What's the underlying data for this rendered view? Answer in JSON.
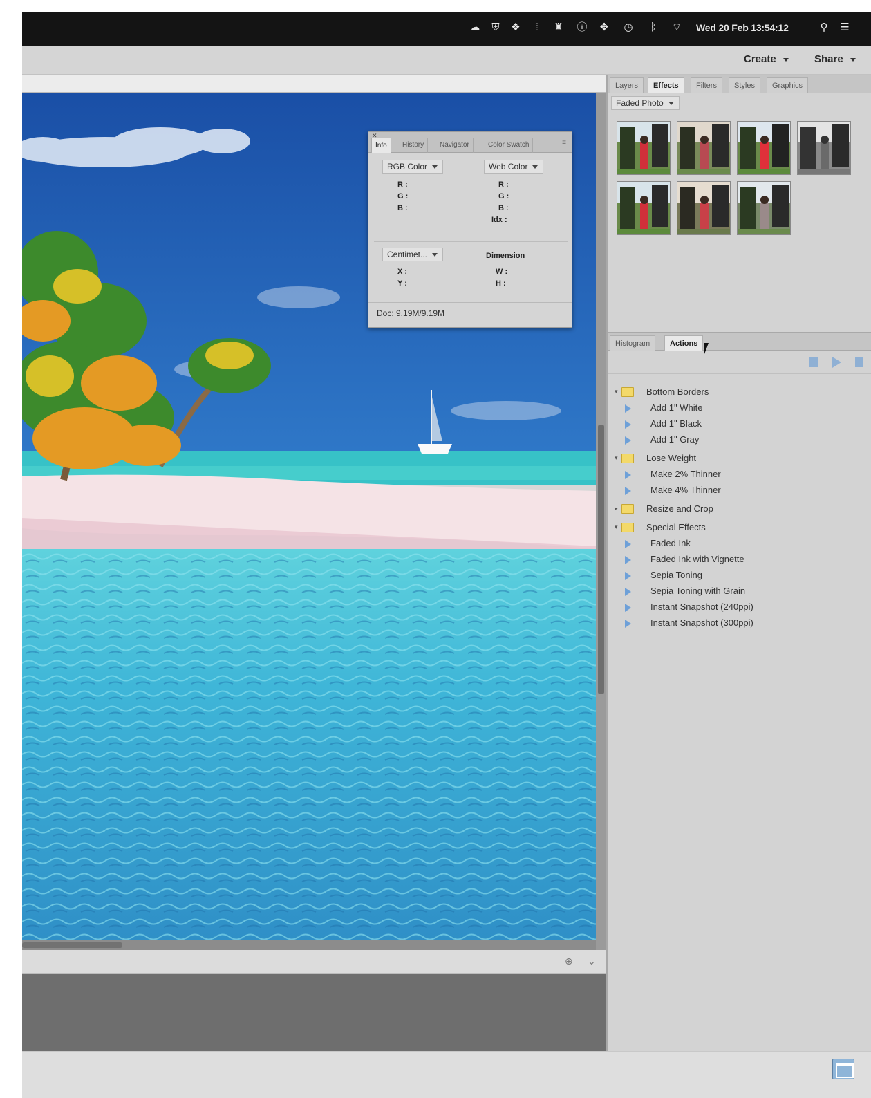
{
  "menubar": {
    "clock": "Wed 20 Feb 13:54:12",
    "icons": [
      "cloud-icon",
      "shield-icon",
      "dropbox-icon",
      "grid-icon",
      "bell-icon",
      "info-icon",
      "compass-icon",
      "clock-icon",
      "bluetooth-icon",
      "wifi-icon",
      "search-icon",
      "list-icon"
    ]
  },
  "topbar": {
    "create_label": "Create",
    "share_label": "Share"
  },
  "effects_panel": {
    "tabs": [
      "Layers",
      "Effects",
      "Filters",
      "Styles",
      "Graphics"
    ],
    "active_tab": "Effects",
    "dropdown_value": "Faded Photo",
    "thumbnail_count": 7
  },
  "info_panel": {
    "tabs": [
      "Info",
      "History",
      "Navigator",
      "Color Swatch"
    ],
    "active_tab": "Info",
    "color_mode_left": "RGB Color",
    "color_mode_right": "Web Color",
    "left_labels": [
      "R :",
      "G :",
      "B :"
    ],
    "right_labels": [
      "R :",
      "G :",
      "B :",
      "Idx :"
    ],
    "units": "Centimet...",
    "dimension_label": "Dimension",
    "xy_labels": [
      "X :",
      "Y :"
    ],
    "wh_labels": [
      "W :",
      "H :"
    ],
    "doc": "Doc: 9.19M/9.19M"
  },
  "actions_panel": {
    "tabs": [
      "Histogram",
      "Actions"
    ],
    "active_tab": "Actions",
    "groups": [
      {
        "name": "Bottom Borders",
        "expanded": true,
        "items": [
          "Add 1\" White",
          "Add 1\" Black",
          "Add 1\" Gray"
        ]
      },
      {
        "name": "Lose Weight",
        "expanded": true,
        "items": [
          "Make 2% Thinner",
          "Make 4% Thinner"
        ]
      },
      {
        "name": "Resize and Crop",
        "expanded": false,
        "items": []
      },
      {
        "name": "Special Effects",
        "expanded": true,
        "items": [
          "Faded Ink",
          "Faded Ink with Vignette",
          "Sepia Toning",
          "Sepia Toning with Grain",
          "Instant Snapshot (240ppi)",
          "Instant Snapshot (300ppi)"
        ]
      }
    ]
  },
  "colors": {
    "sky_top": "#1a4fa6",
    "sky_bottom": "#2f78c8",
    "lagoon": "#3fc5c9",
    "sand": "#f3dfe2",
    "water": "#3ea6cf",
    "folder": "#f3d96a",
    "play_triangle": "#6ea0d8"
  }
}
